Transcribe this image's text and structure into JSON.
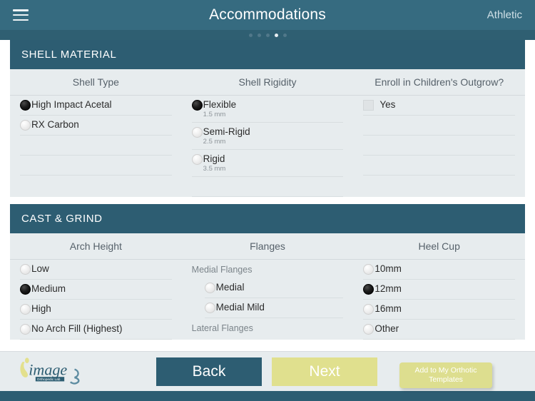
{
  "header": {
    "menu_icon": "hamburger-icon",
    "title": "Accommodations",
    "right_label": "Athletic",
    "pager": {
      "total": 5,
      "active_index": 3
    },
    "bg_color": "#366b80"
  },
  "sections": [
    {
      "id": "shell-material",
      "title": "SHELL MATERIAL",
      "columns": [
        {
          "id": "shell-type",
          "heading": "Shell Type",
          "options": [
            {
              "label": "High Impact Acetal",
              "sub": "",
              "type": "radio",
              "selected": true
            },
            {
              "label": "RX Carbon",
              "sub": "",
              "type": "radio",
              "selected": false
            },
            {
              "label": "",
              "sub": "",
              "type": "blank",
              "selected": false
            },
            {
              "label": "",
              "sub": "",
              "type": "blank",
              "selected": false
            }
          ]
        },
        {
          "id": "shell-rigidity",
          "heading": "Shell Rigidity",
          "options": [
            {
              "label": "Flexible",
              "sub": "1.5 mm",
              "type": "radio",
              "selected": true
            },
            {
              "label": "Semi-Rigid",
              "sub": "2.5 mm",
              "type": "radio",
              "selected": false
            },
            {
              "label": "Rigid",
              "sub": "3.5 mm",
              "type": "radio",
              "selected": false
            },
            {
              "label": "",
              "sub": "",
              "type": "blank",
              "selected": false
            }
          ]
        },
        {
          "id": "childrens-outgrow",
          "heading": "Enroll in Children's Outgrow?",
          "options": [
            {
              "label": "Yes",
              "sub": "",
              "type": "checkbox",
              "selected": false
            },
            {
              "label": "",
              "sub": "",
              "type": "blank",
              "selected": false
            },
            {
              "label": "",
              "sub": "",
              "type": "blank",
              "selected": false
            },
            {
              "label": "",
              "sub": "",
              "type": "blank",
              "selected": false
            }
          ]
        }
      ]
    },
    {
      "id": "cast-and-grind",
      "title": "CAST & GRIND",
      "columns": [
        {
          "id": "arch-height",
          "heading": "Arch Height",
          "options": [
            {
              "label": "Low",
              "sub": "",
              "type": "radio",
              "selected": false
            },
            {
              "label": "Medium",
              "sub": "",
              "type": "radio",
              "selected": true
            },
            {
              "label": "High",
              "sub": "",
              "type": "radio",
              "selected": false
            },
            {
              "label": "No Arch Fill (Highest)",
              "sub": "",
              "type": "radio",
              "selected": false
            }
          ]
        },
        {
          "id": "flanges",
          "heading": "Flanges",
          "group_label_1": "Medial Flanges",
          "group_label_2": "Lateral Flanges",
          "options": [
            {
              "label": "Medial",
              "sub": "",
              "type": "radio",
              "selected": false
            },
            {
              "label": "Medial Mild",
              "sub": "",
              "type": "radio",
              "selected": false
            }
          ]
        },
        {
          "id": "heel-cup",
          "heading": "Heel Cup",
          "options": [
            {
              "label": "10mm",
              "sub": "",
              "type": "radio",
              "selected": false
            },
            {
              "label": "12mm",
              "sub": "",
              "type": "radio",
              "selected": true
            },
            {
              "label": "16mm",
              "sub": "",
              "type": "radio",
              "selected": false
            },
            {
              "label": "Other",
              "sub": "",
              "type": "radio",
              "selected": false
            }
          ]
        }
      ]
    }
  ],
  "footer": {
    "logo_word": "image",
    "logo_sub": "Orthopedic Lab",
    "back_label": "Back",
    "next_label": "Next",
    "template_label": "Add to My Orthotic Templates",
    "back_color": "#2d5d72",
    "next_color": "#e0e08e"
  }
}
